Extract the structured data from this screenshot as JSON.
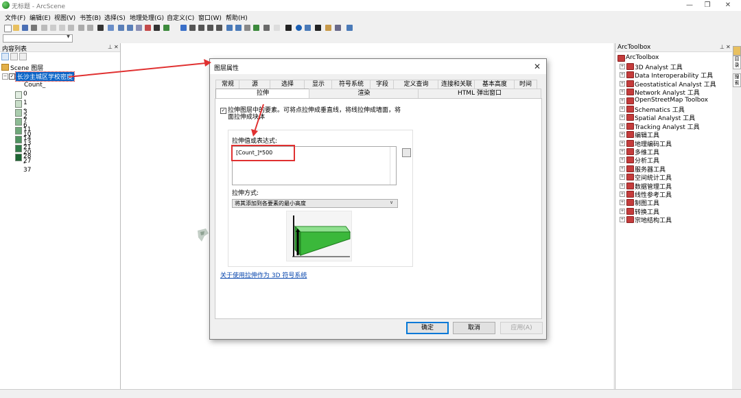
{
  "window": {
    "title": "无标题 - ArcScene",
    "controls": [
      "—",
      "❐",
      "✕"
    ]
  },
  "menubar": {
    "items": [
      "文件(F)",
      "编辑(E)",
      "视图(V)",
      "书签(B)",
      "选择(S)",
      "地理处理(G)",
      "自定义(C)",
      "窗口(W)",
      "帮助(H)"
    ]
  },
  "toc": {
    "title": "内容列表",
    "scene_label": "Scene 图层",
    "layer_label": "长沙主城区学校密度",
    "field_label": "Count_",
    "legend": [
      {
        "label": "0",
        "color": "#e2ede2"
      },
      {
        "label": "1 - 2",
        "color": "#c9dec9"
      },
      {
        "label": "3 - 6",
        "color": "#aacdae"
      },
      {
        "label": "7 - 10",
        "color": "#8dbb94"
      },
      {
        "label": "11 - 13",
        "color": "#6fa87a"
      },
      {
        "label": "14 - 20",
        "color": "#4f9461"
      },
      {
        "label": "21 - 27",
        "color": "#327d4a"
      },
      {
        "label": "28 - 37",
        "color": "#1c6533"
      }
    ]
  },
  "toolbox": {
    "title": "ArcToolbox",
    "root": "ArcToolbox",
    "items": [
      "3D Analyst 工具",
      "Data Interoperability 工具",
      "Geostatistical Analyst 工具",
      "Network Analyst 工具",
      "OpenStreetMap Toolbox",
      "Schematics 工具",
      "Spatial Analyst 工具",
      "Tracking Analyst 工具",
      "编辑工具",
      "地理编码工具",
      "多维工具",
      "分析工具",
      "服务器工具",
      "空间统计工具",
      "数据管理工具",
      "线性参考工具",
      "制图工具",
      "转换工具",
      "宗地结构工具"
    ],
    "side_tabs": [
      "目",
      "录",
      "搜",
      "索"
    ]
  },
  "dialog": {
    "title": "图层属性",
    "tabs_row1": [
      "常规",
      "源",
      "选择",
      "显示",
      "符号系统",
      "字段",
      "定义查询",
      "连接和关联",
      "基本高度",
      "时间"
    ],
    "tabs_row2": [
      "拉伸",
      "渲染",
      "HTML 弹出窗口"
    ],
    "active_tab": "拉伸",
    "extrude_checkbox_label": "拉伸图层中的要素。可将点拉伸成垂直线，将线拉伸成墙面，将面拉伸成块体",
    "expression_label": "拉伸值或表达式:",
    "expression_value": "[Count_]*500",
    "method_label": "拉伸方式:",
    "method_value": "将其添加到各要素的最小高度",
    "help_link": "关于使用拉伸作为 3D 符号系统",
    "buttons": {
      "ok": "确定",
      "cancel": "取消",
      "apply": "应用(A)"
    }
  },
  "colors": {
    "selection_blue": "#0a64c8",
    "highlight_red": "#e03030",
    "toolbox_red": "#c43c3c",
    "preview_green": "#3bb83b"
  }
}
